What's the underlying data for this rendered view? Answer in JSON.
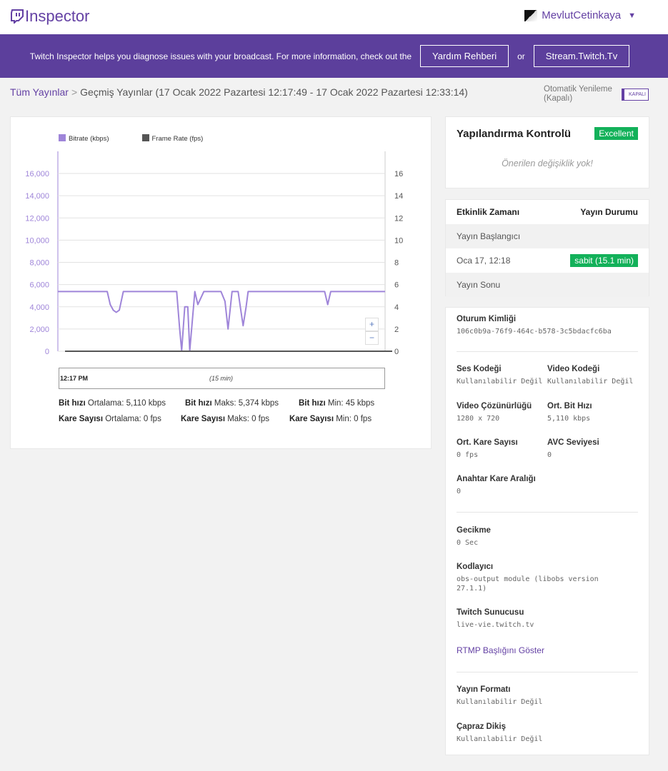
{
  "app": {
    "logo": "Inspector"
  },
  "user": {
    "name": "MevlutCetinkaya",
    "caret": "▼"
  },
  "banner": {
    "text": "Twitch Inspector helps you diagnose issues with your broadcast. For more information, check out the",
    "help_btn": "Yardım Rehberi",
    "or": "or",
    "site_btn": "Stream.Twitch.Tv"
  },
  "breadcrumb": {
    "root": "Tüm Yayınlar",
    "sep": ">",
    "current": "Geçmiş Yayınlar (17 Ocak 2022 Pazartesi 12:17:49 - 17 Ocak 2022 Pazartesi 12:33:14)"
  },
  "auto_refresh": {
    "label1": "Otomatik Yenileme",
    "label2": "(Kapalı)",
    "toggle": "KAPALI"
  },
  "legend": {
    "bitrate": "Bitrate (kbps)",
    "framerate": "Frame Rate (fps)"
  },
  "colors": {
    "bitrate": "#9f85d9",
    "framerate": "#555555",
    "brand": "#6441a4",
    "ok": "#13b15a"
  },
  "chart_data": {
    "type": "line",
    "ylim_left": [
      0,
      16000
    ],
    "ylim_right": [
      0,
      16
    ],
    "yticks_left": [
      "0",
      "2,000",
      "4,000",
      "6,000",
      "8,000",
      "10,000",
      "12,000",
      "14,000",
      "16,000"
    ],
    "yticks_right": [
      "0",
      "2",
      "4",
      "6",
      "8",
      "10",
      "12",
      "14",
      "16"
    ],
    "grid": true,
    "series": [
      {
        "name": "Bitrate (kbps)",
        "x_minutes": [
          0,
          4.9,
          5.2,
          5.5,
          5.8,
          6.1,
          6.5,
          11.8,
          12.1,
          12.3,
          12.6,
          12.9,
          13.1,
          13.6,
          13.9,
          14.5,
          16.2,
          16.6,
          16.9,
          17.3,
          17.9,
          18.2,
          18.4,
          18.7,
          18.9,
          25.4,
          26.5,
          26.8,
          27.1,
          32.5
        ],
        "values": [
          5374,
          5374,
          4200,
          3700,
          3500,
          3700,
          5374,
          5374,
          2000,
          45,
          4000,
          4000,
          45,
          5374,
          4200,
          5374,
          5374,
          4500,
          2000,
          5374,
          5374,
          3500,
          2300,
          4000,
          5374,
          5374,
          5374,
          4200,
          5374,
          5374
        ]
      },
      {
        "name": "Frame Rate (fps)",
        "x_minutes": [
          0,
          32.5
        ],
        "values": [
          0,
          0
        ]
      }
    ],
    "timeline_start": "12:17 PM",
    "timeline_span": "(15 min)"
  },
  "stats": {
    "bit_label": "Bit hızı",
    "bit_avg": "Ortalama: 5,110 kbps",
    "bit_max": "Maks: 5,374 kbps",
    "bit_min": "Min: 45 kbps",
    "fr_label": "Kare Sayısı",
    "fr_avg": "Ortalama: 0 fps",
    "fr_max": "Maks: 0 fps",
    "fr_min": "Min: 0 fps"
  },
  "config": {
    "title": "Yapılandırma Kontrolü",
    "badge": "Excellent",
    "message": "Önerilen değişiklik yok!"
  },
  "events": {
    "col1": "Etkinlik Zamanı",
    "col2": "Yayın Durumu",
    "start": "Yayın Başlangıcı",
    "time": "Oca 17, 12:18",
    "status": "sabit (15.1 min)",
    "end": "Yayın Sonu"
  },
  "session": {
    "id_label": "Oturum Kimliği",
    "id_value": "106c0b9a-76f9-464c-b578-3c5bdacfc6ba",
    "audio_label": "Ses Kodeği",
    "audio_value": "Kullanılabilir Değil",
    "video_label": "Video Kodeği",
    "video_value": "Kullanılabilir Değil",
    "res_label": "Video Çözünürlüğü",
    "res_value": "1280 x 720",
    "avgbit_label": "Ort. Bit Hızı",
    "avgbit_value": "5,110 kbps",
    "avgfps_label": "Ort. Kare Sayısı",
    "avgfps_value": "0 fps",
    "avc_label": "AVC Seviyesi",
    "avc_value": "0",
    "key_label": "Anahtar Kare Aralığı",
    "key_value": "0",
    "latency_label": "Gecikme",
    "latency_value": "0 Sec",
    "encoder_label": "Kodlayıcı",
    "encoder_value": "obs-output module (libobs version 27.1.1)",
    "server_label": "Twitch Sunucusu",
    "server_value": "live-vie.twitch.tv",
    "rtmp_link": "RTMP Başlığını Göster",
    "format_label": "Yayın Formatı",
    "format_value": "Kullanılabilir Değil",
    "cross_label": "Çapraz Dikiş",
    "cross_value": "Kullanılabilir Değil"
  }
}
